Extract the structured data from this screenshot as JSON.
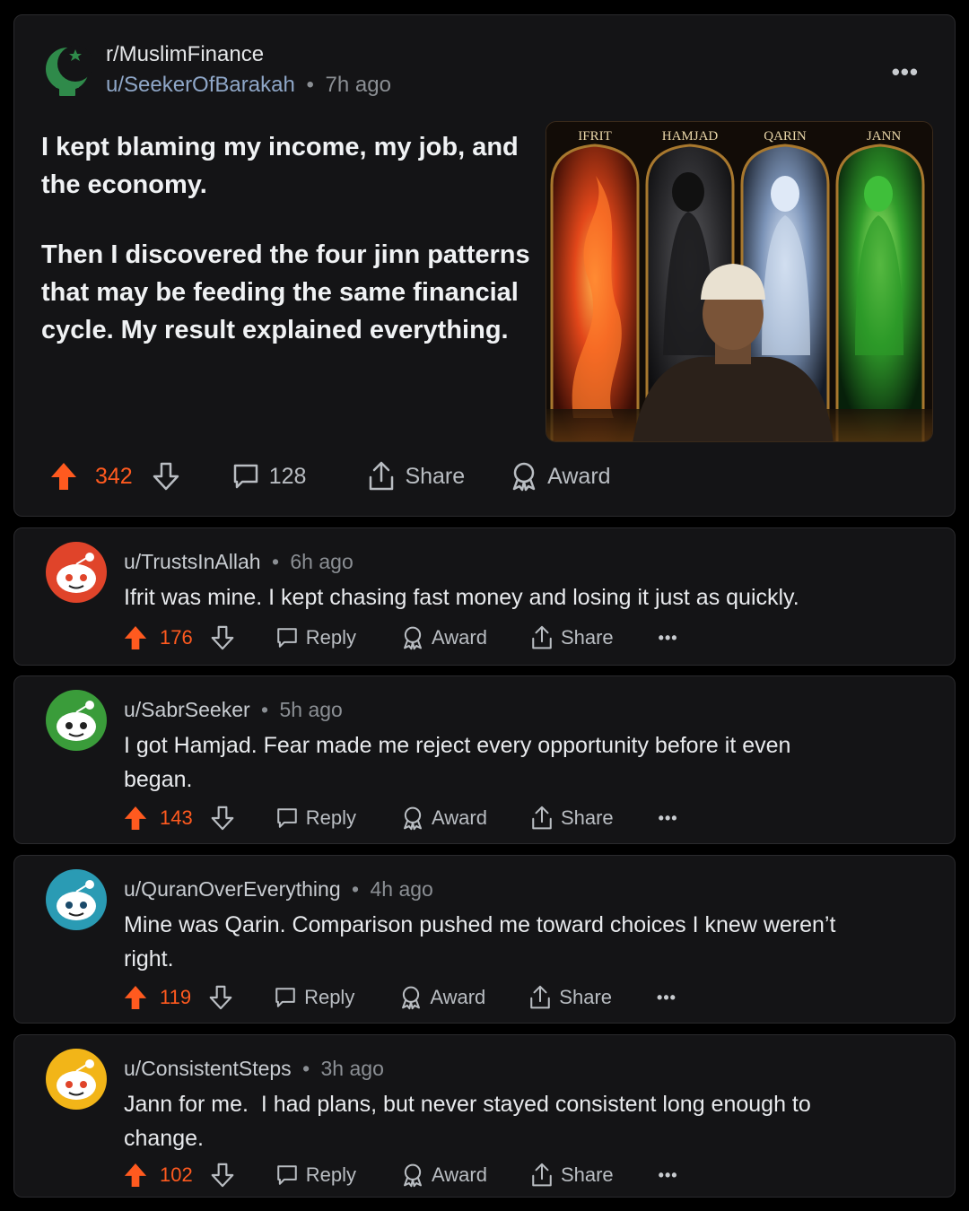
{
  "post": {
    "subreddit": "r/MuslimFinance",
    "author": "u/SeekerOfBarakah",
    "separator": "•",
    "time": "7h ago",
    "more_label": "•••",
    "paragraph1": "I kept blaming my income, my job, and the economy.",
    "paragraph2": "Then I discovered the four jinn patterns that may be feeding the same financial cycle. My result explained everything.",
    "image_labels": [
      "IFRIT",
      "HAMJAD",
      "QARIN",
      "JANN"
    ],
    "upvotes": "342",
    "comments": "128",
    "share_label": "Share",
    "award_label": "Award"
  },
  "colors": {
    "upvote": "#ff5a1f",
    "background": "#000000",
    "card": "#141416"
  },
  "comments": [
    {
      "author": "u/TrustsInAllah",
      "time": "6h ago",
      "text": "Ifrit was mine. I kept chasing fast money and losing it just as quickly.",
      "upvotes": "176",
      "avatar_color": "#e0442a"
    },
    {
      "author": "u/SabrSeeker",
      "time": "5h ago",
      "text": "I got Hamjad. Fear made me reject every opportunity before it even began.",
      "upvotes": "143",
      "avatar_color": "#3a9c3a"
    },
    {
      "author": "u/QuranOverEverything",
      "time": "4h ago",
      "text": "Mine was Qarin. Comparison pushed me toward choices I knew weren’t right.",
      "upvotes": "119",
      "avatar_color": "#2a9bb4"
    },
    {
      "author": "u/ConsistentSteps",
      "time": "3h ago",
      "text": "Jann for me.  I had plans, but never stayed consistent long enough to change.",
      "upvotes": "102",
      "avatar_color": "#f2b518"
    }
  ],
  "comment_actions": {
    "reply": "Reply",
    "award": "Award",
    "share": "Share",
    "more": "•••"
  }
}
